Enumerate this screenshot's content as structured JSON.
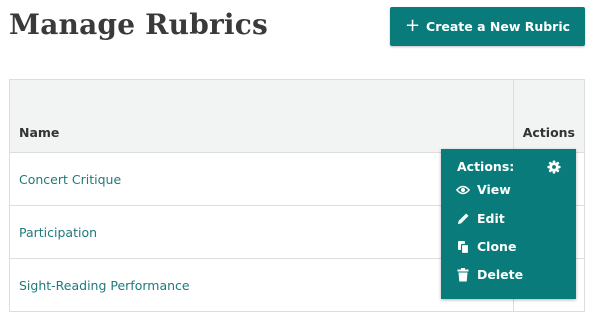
{
  "page": {
    "title": "Manage Rubrics"
  },
  "toolbar": {
    "create_label": "Create a New Rubric",
    "create_icon": "plus-icon"
  },
  "table": {
    "columns": [
      "Name",
      "Actions"
    ],
    "rows": [
      {
        "name": "Concert Critique"
      },
      {
        "name": "Participation"
      },
      {
        "name": "Sight-Reading Performance"
      }
    ]
  },
  "actions_menu": {
    "header": "Actions:",
    "settings_icon": "gear-icon",
    "items": [
      {
        "label": "View",
        "icon": "eye-icon"
      },
      {
        "label": "Edit",
        "icon": "pencil-icon"
      },
      {
        "label": "Clone",
        "icon": "copy-icon"
      },
      {
        "label": "Delete",
        "icon": "trash-icon"
      }
    ]
  },
  "colors": {
    "accent": "#0a7b7b",
    "link": "#1f7a7a",
    "header_bg": "#f2f4f3",
    "border": "#dddddd"
  }
}
